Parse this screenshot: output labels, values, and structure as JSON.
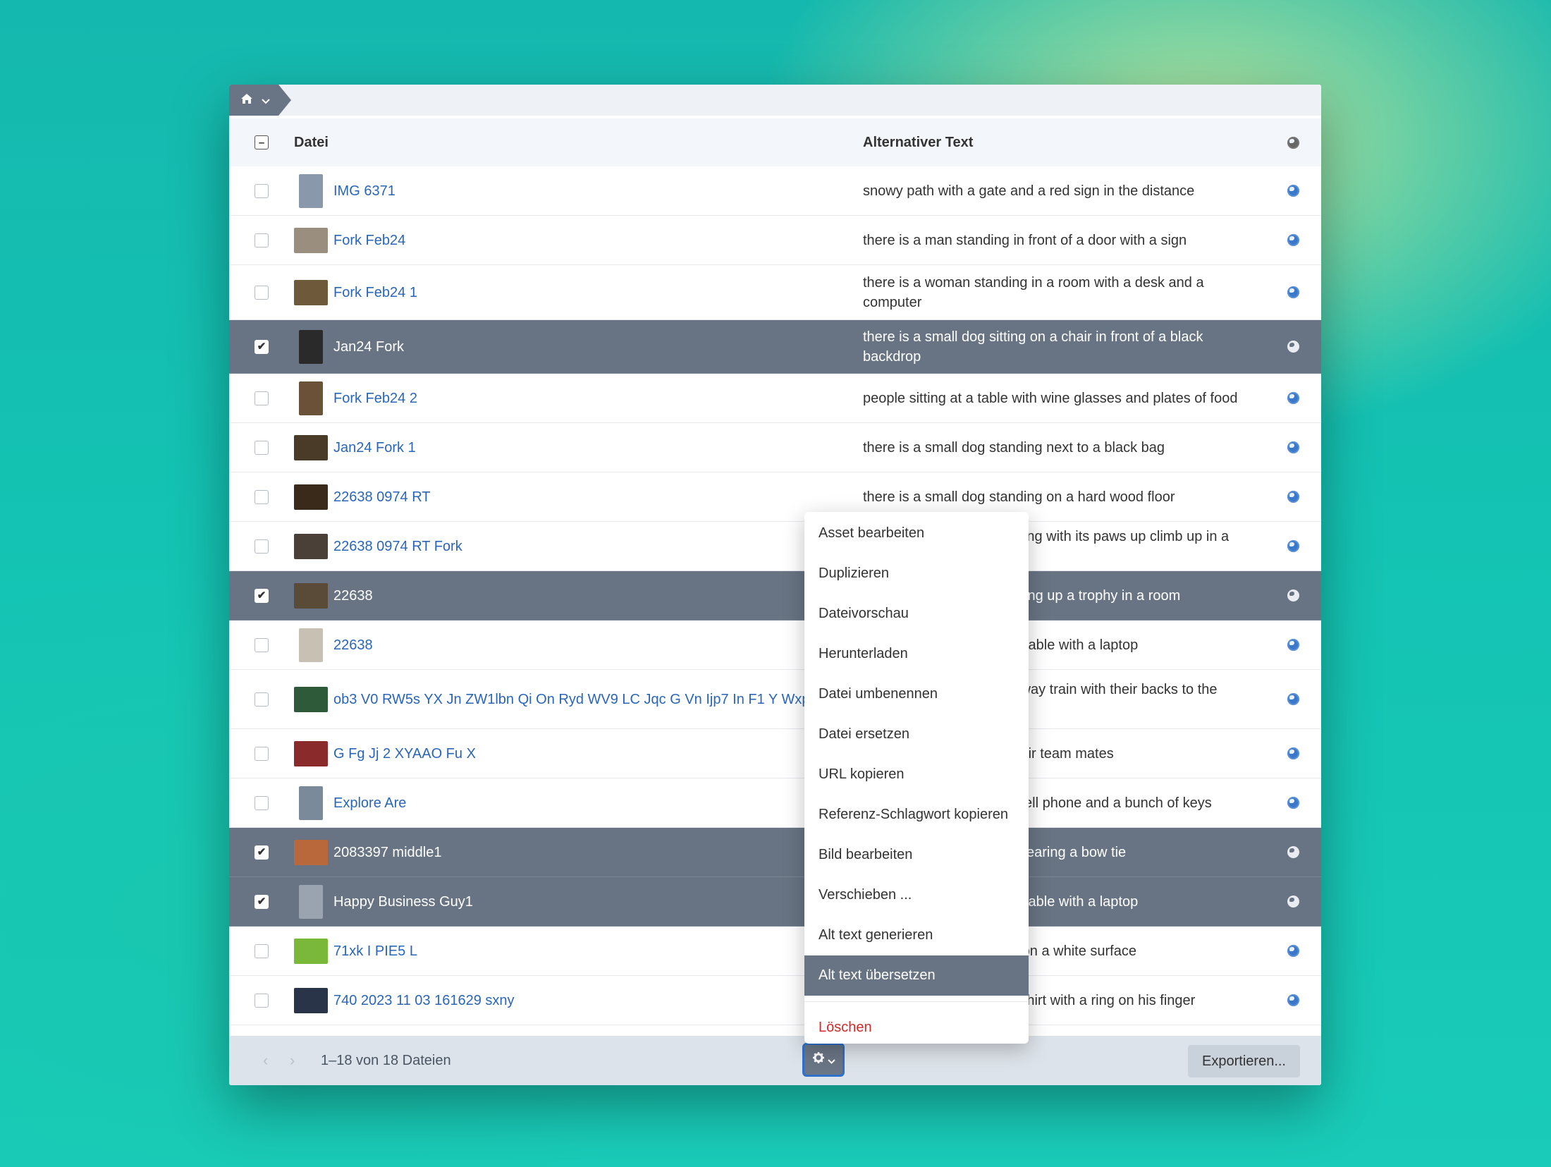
{
  "breadcrumb": {
    "home_icon": "home-icon"
  },
  "table": {
    "header_file": "Datei",
    "header_alt": "Alternativer Text",
    "rows": [
      {
        "file": "IMG 6371",
        "alt": "snowy path with a gate and a red sign in the distance",
        "selected": false,
        "thumb_color": "#8a98ab"
      },
      {
        "file": "Fork Feb24",
        "alt": "there is a man standing in front of a door with a sign",
        "selected": false,
        "thumb_color": "#9a8e7f"
      },
      {
        "file": "Fork Feb24 1",
        "alt": "there is a woman standing in a room with a desk and a computer",
        "selected": false,
        "thumb_color": "#6e5a3a"
      },
      {
        "file": "Jan24 Fork",
        "alt": "there is a small dog sitting on a chair in front of a black backdrop",
        "selected": true,
        "thumb_color": "#2a2a2a"
      },
      {
        "file": "Fork Feb24 2",
        "alt": "people sitting at a table with wine glasses and plates of food",
        "selected": false,
        "thumb_color": "#6b5138"
      },
      {
        "file": "Jan24 Fork 1",
        "alt": "there is a small dog standing next to a black bag",
        "selected": false,
        "thumb_color": "#4a3a28"
      },
      {
        "file": "22638 0974 RT",
        "alt": "there is a small dog standing on a hard wood floor",
        "selected": false,
        "thumb_color": "#3a2a1a"
      },
      {
        "file": "22638 0974 RT Fork",
        "alt": "there is a small dog standing with its paws up climb up in a trash can",
        "selected": false,
        "thumb_color": "#4a4038"
      },
      {
        "file": "22638",
        "alt": "there is a man that is holding up a trophy in a room",
        "selected": true,
        "thumb_color": "#5a4a38"
      },
      {
        "file": "22638",
        "alt": "there is a man sitting at a table with a laptop",
        "selected": false,
        "thumb_color": "#c9c0b4"
      },
      {
        "file": "ob3 V0 RW5s YX Jn ZW1lbn Qi On Ryd WV9 LC Jqc G Vn Ijp7 In F1 Y Wxp Hki Ojk",
        "alt": "people standing on a subway train with their backs to the camera",
        "selected": false,
        "thumb_color": "#2e5a3a"
      },
      {
        "file": "G Fg Jj 2 XYAAO Fu X",
        "alt": "a group of players with their team mates",
        "selected": false,
        "thumb_color": "#8a2a2a"
      },
      {
        "file": "Explore Are",
        "alt": "there is a man holding a cell phone and a bunch of keys",
        "selected": false,
        "thumb_color": "#7a8a9a"
      },
      {
        "file": "2083397 middle1",
        "alt": "there is a stuffed animal wearing a bow tie",
        "selected": true,
        "thumb_color": "#b8683a"
      },
      {
        "file": "Happy Business Guy1",
        "alt": "there is a man sitting at a table with a laptop",
        "selected": true,
        "thumb_color": "#9aa4b0"
      },
      {
        "file": "71xk I PIE5 L",
        "alt": "there are two cucumbers on a white surface",
        "selected": false,
        "thumb_color": "#7ab83a"
      },
      {
        "file": "740 2023 11 03 161629 sxny",
        "alt": "there is a man in a white shirt with a ring on his finger",
        "selected": false,
        "thumb_color": "#2a3448"
      }
    ]
  },
  "context_menu": {
    "items": [
      "Asset bearbeiten",
      "Duplizieren",
      "Dateivorschau",
      "Herunterladen",
      "Datei umbenennen",
      "Datei ersetzen",
      "URL kopieren",
      "Referenz-Schlagwort kopieren",
      "Bild bearbeiten",
      "Verschieben ...",
      "Alt text generieren",
      "Alt text übersetzen"
    ],
    "active_item": "Alt text übersetzen",
    "delete_label": "Löschen"
  },
  "footer": {
    "prev": "‹",
    "next": "›",
    "count": "1–18 von 18 Dateien",
    "export_label": "Exportieren..."
  },
  "colors": {
    "accent": "#2a66b8",
    "selected_row": "#687483",
    "danger": "#d02a2a"
  }
}
